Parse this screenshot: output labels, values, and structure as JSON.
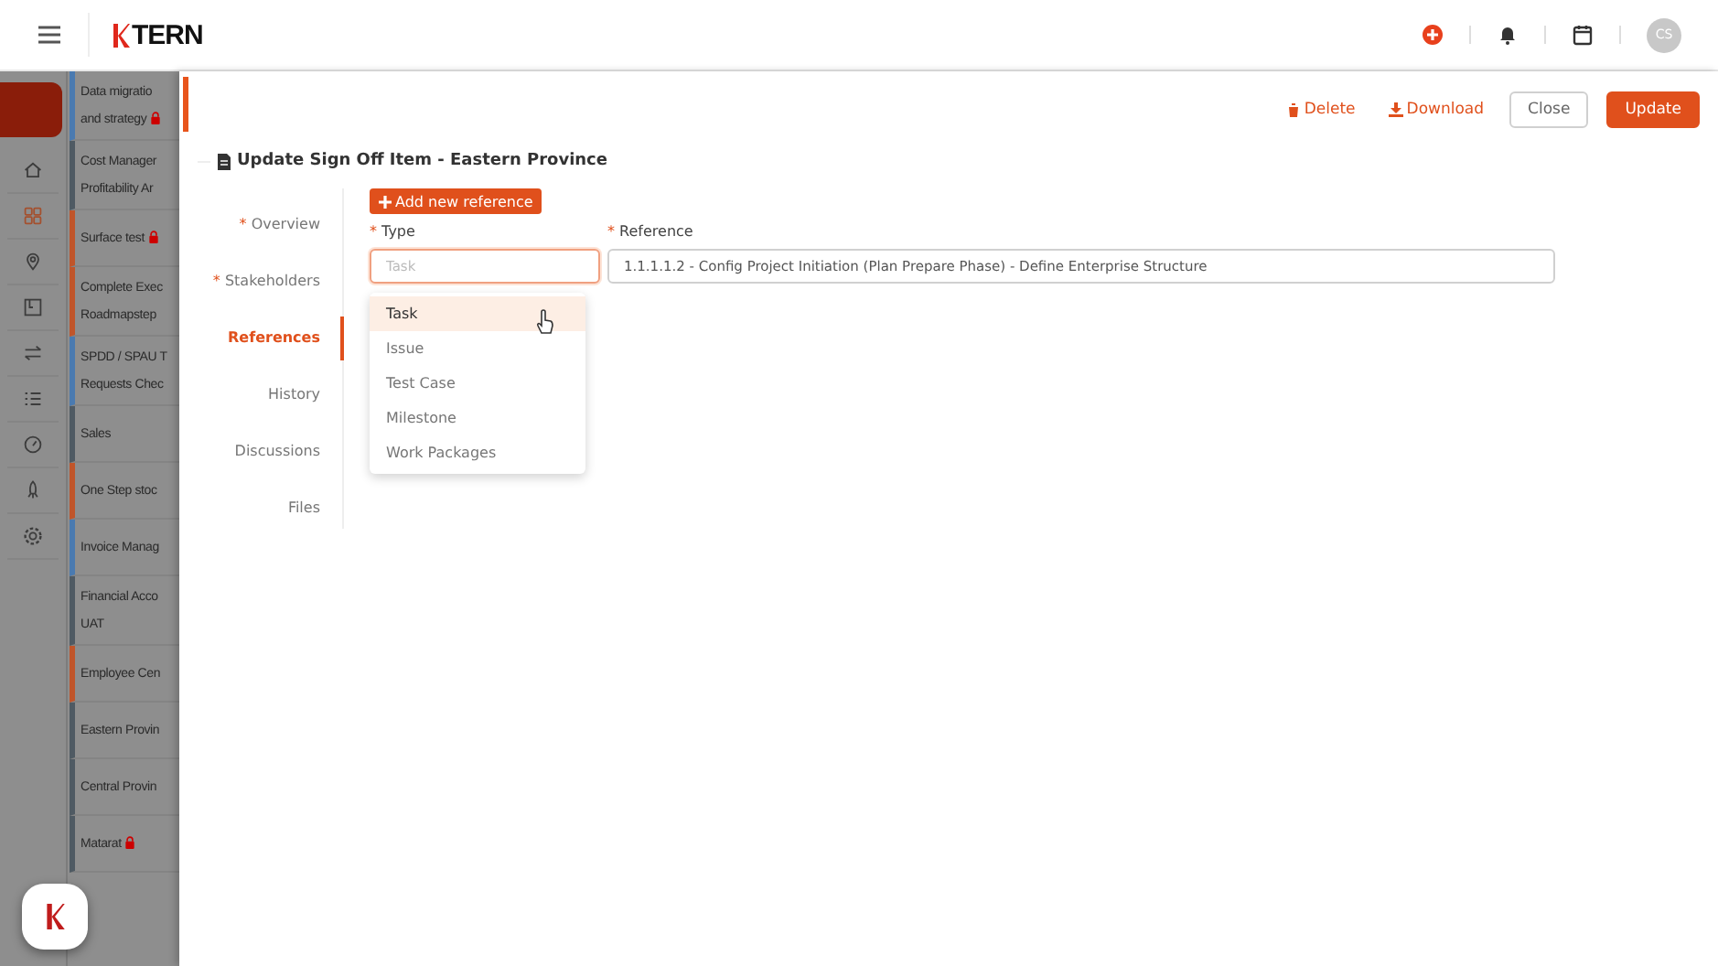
{
  "header": {
    "logo": "TERN",
    "avatar": "CS"
  },
  "rail": {
    "items": [
      {
        "selected": false
      },
      {
        "selected": true
      },
      {
        "selected": false
      },
      {
        "selected": false
      },
      {
        "selected": false
      },
      {
        "selected": false
      },
      {
        "selected": false
      },
      {
        "selected": false
      },
      {
        "selected": false
      }
    ]
  },
  "projects": [
    {
      "lines": [
        "Data migratio",
        "and strategy"
      ],
      "locked": true,
      "color": "#4a7ab0"
    },
    {
      "lines": [
        "Cost Manager",
        "Profitability Ar"
      ],
      "locked": false,
      "color": "#4f5a63"
    },
    {
      "lines": [
        "Surface test"
      ],
      "locked": true,
      "color": "#c0552a"
    },
    {
      "lines": [
        "Complete Exec",
        "Roadmapstep"
      ],
      "locked": false,
      "color": "#c0552a"
    },
    {
      "lines": [
        "SPDD / SPAU T",
        "Requests Chec"
      ],
      "locked": false,
      "color": "#4a7ab0"
    },
    {
      "lines": [
        "Sales"
      ],
      "locked": false,
      "color": "#4f5a63"
    },
    {
      "lines": [
        "One Step stoc"
      ],
      "locked": false,
      "color": "#c0552a"
    },
    {
      "lines": [
        "Invoice Manag"
      ],
      "locked": false,
      "color": "#4a7ab0"
    },
    {
      "lines": [
        "Financial Acco",
        "UAT"
      ],
      "locked": false,
      "color": "#4f5a63"
    },
    {
      "lines": [
        "Employee Cen"
      ],
      "locked": false,
      "color": "#c0552a"
    },
    {
      "lines": [
        "Eastern Provin"
      ],
      "locked": false,
      "color": "#4f5a63"
    },
    {
      "lines": [
        "Central Provin"
      ],
      "locked": false,
      "color": "#4f5a63"
    },
    {
      "lines": [
        "Matarat"
      ],
      "locked": true,
      "color": "#4f5a63"
    }
  ],
  "actions": [
    {
      "label": "Delete",
      "kind": "delete"
    },
    {
      "label": "Download",
      "kind": "download"
    },
    {
      "label": "Close",
      "kind": "outline"
    },
    {
      "label": "Update",
      "kind": "primary"
    }
  ],
  "title": "Update Sign Off Item - Eastern Province",
  "sections": [
    {
      "label": "Overview",
      "marker": "*",
      "selected": false
    },
    {
      "label": "Stakeholders",
      "marker": "*",
      "selected": false
    },
    {
      "label": "References",
      "selected": true
    },
    {
      "label": "History",
      "selected": false
    },
    {
      "label": "Discussions",
      "selected": false
    },
    {
      "label": "Files",
      "selected": false
    }
  ],
  "add_button": "Add new reference",
  "type_field": {
    "label": "Type",
    "marker": "*",
    "placeholder": "Task",
    "focused": true
  },
  "reference_field": {
    "label": "Reference",
    "marker": "*",
    "value": "1.1.1.1.2 - Config Project Initiation (Plan Prepare Phase) - Define Enterprise Structure"
  },
  "type_options": [
    {
      "label": "Task",
      "selected": true
    },
    {
      "label": "Issue",
      "selected": false
    },
    {
      "label": "Test Case",
      "selected": false
    },
    {
      "label": "Milestone",
      "selected": false
    },
    {
      "label": "Work Packages",
      "selected": false
    }
  ]
}
